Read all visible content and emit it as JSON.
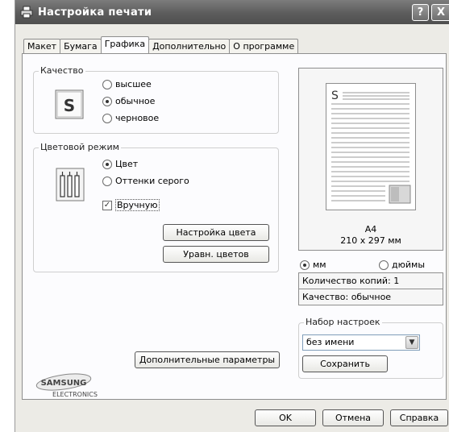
{
  "window": {
    "title": "Настройка печати",
    "help_label": "?",
    "close_label": "X"
  },
  "tabs": [
    {
      "label": "Макет"
    },
    {
      "label": "Бумага"
    },
    {
      "label": "Графика"
    },
    {
      "label": "Дополнительно"
    },
    {
      "label": "О программе"
    }
  ],
  "quality": {
    "label": "Качество",
    "options": [
      "высшее",
      "обычное",
      "черновое"
    ],
    "selected": "обычное"
  },
  "color_mode": {
    "label": "Цветовой режим",
    "options": [
      "Цвет",
      "Оттенки серого"
    ],
    "selected": "Цвет",
    "manual_label": "Вручную",
    "manual_checked": true,
    "color_settings_label": "Настройка цвета",
    "color_match_label": "Уравн. цветов"
  },
  "advanced_button": "Дополнительные параметры",
  "preview": {
    "paper": "A4",
    "size": "210 x 297 мм",
    "glyph": "S"
  },
  "units": {
    "options": [
      "мм",
      "дюймы"
    ],
    "selected": "мм"
  },
  "copies": "Количество копий: 1",
  "quality_info": "Качество: обычное",
  "presets": {
    "label": "Набор настроек",
    "value": "без имени",
    "save_label": "Сохранить"
  },
  "logo": {
    "brand": "SAMSUNG",
    "sub": "ELECTRONICS"
  },
  "footer": {
    "ok": "OK",
    "cancel": "Отмена",
    "help": "Справка"
  }
}
